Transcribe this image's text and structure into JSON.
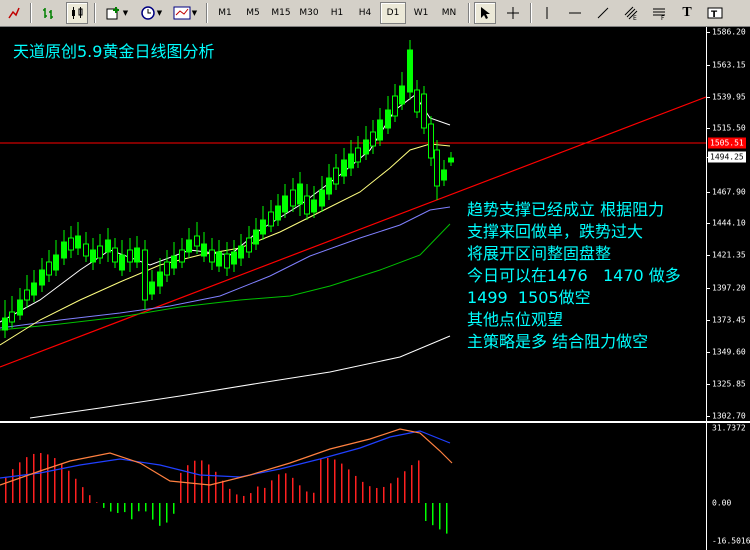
{
  "toolbar": {
    "timeframes": [
      "M1",
      "M5",
      "M15",
      "M30",
      "H1",
      "H4",
      "D1",
      "W1",
      "MN"
    ],
    "active_timeframe": "D1"
  },
  "chart": {
    "title": "天道原创5.9黄金日线图分析",
    "notes": [
      "趋势支撑已经成立 根据阻力",
      "支撑来回做单，跌势过大",
      "将展开区间整固盘整",
      "今日可以在1476   1470 做多",
      "1499  1505做空",
      "其他点位观望",
      "主策略是多 结合阻力做空"
    ],
    "price_axis": [
      "1586.20",
      "1563.15",
      "1539.95",
      "1515.50",
      "1494.25",
      "1467.90",
      "1444.10",
      "1421.35",
      "1397.20",
      "1373.45",
      "1349.60",
      "1325.85",
      "1302.70"
    ],
    "current_price": "1494.25",
    "resistance_price": "1505.51",
    "indicator_axis": [
      "31.7372",
      "0.00",
      "-16.5016"
    ]
  },
  "colors": {
    "bull": "#00ff00",
    "bear": "#000000",
    "resistance": "#ff0000",
    "trendline": "#ff0000",
    "ma_fast": "#ffffff",
    "ma_mid": "#ffff80",
    "ma_slow1": "#8080ff",
    "ma_slow2": "#00c000",
    "ma_long": "#ffffff",
    "text": "#00ffff"
  }
}
